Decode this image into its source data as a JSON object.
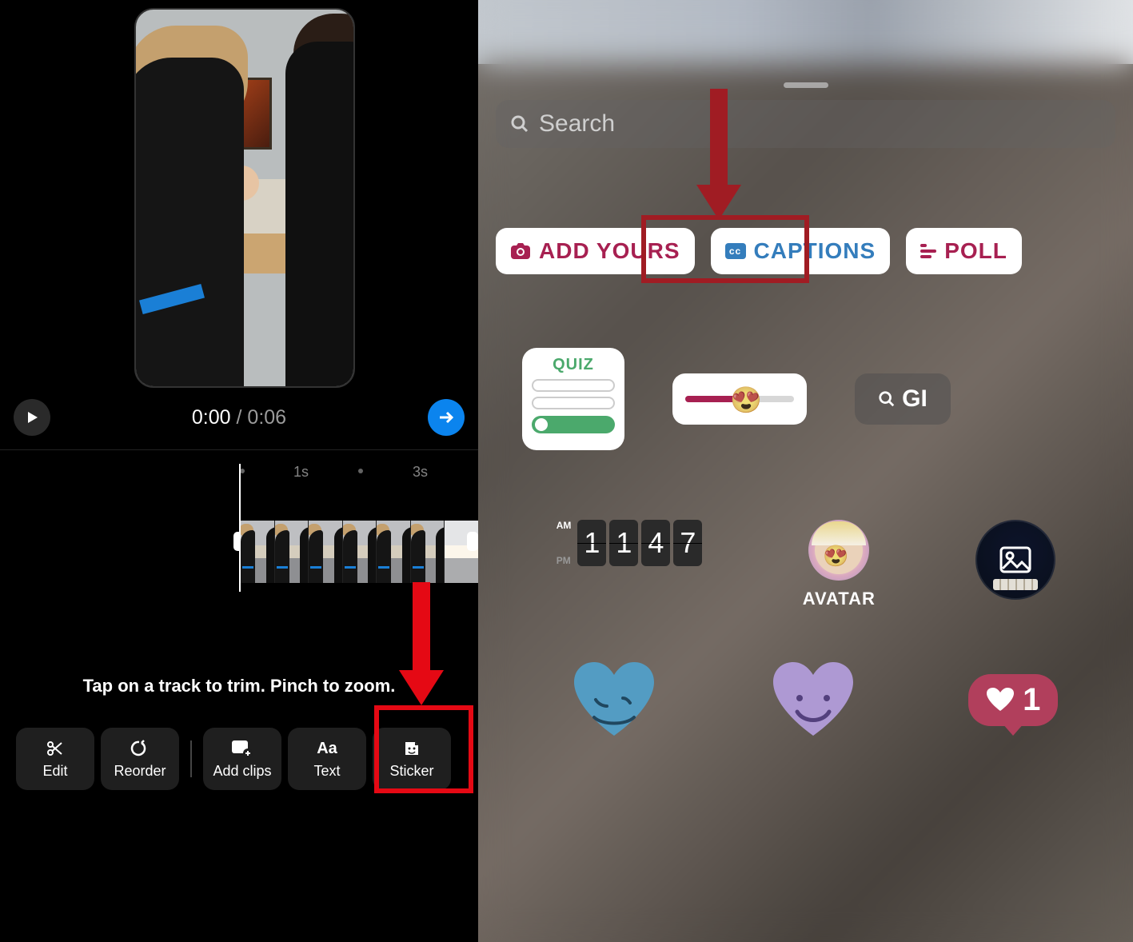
{
  "left": {
    "time_current": "0:00",
    "time_separator": " / ",
    "time_total": "0:06",
    "ruler": {
      "a": "1s",
      "b": "3s"
    },
    "hint": "Tap on a track to trim. Pinch to zoom.",
    "toolbar": {
      "edit": "Edit",
      "reorder": "Reorder",
      "addclips": "Add clips",
      "text": "Text",
      "sticker": "Sticker"
    }
  },
  "right": {
    "search_placeholder": "Search",
    "chips": {
      "addyours": "ADD YOURS",
      "captions": "CAPTIONS",
      "cc": "cc",
      "poll": "POLL"
    },
    "quiz_label": "QUIZ",
    "gif_label": "GI",
    "clock": {
      "am": "AM",
      "pm": "PM",
      "h1": "1",
      "h2": "1",
      "m1": "4",
      "m2": "7"
    },
    "avatar_label": "AVATAR",
    "like_count": "1"
  }
}
